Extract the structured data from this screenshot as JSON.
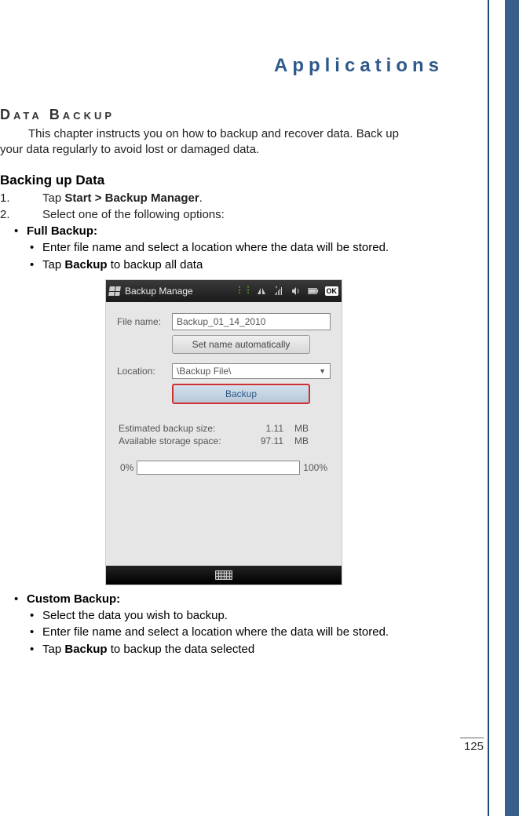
{
  "page_number": "125",
  "chapter_title": "Applications",
  "section_title": "Data Backup",
  "intro_line1": "This chapter instructs you on how to backup and recover data. Back up",
  "intro_line2": "your data regularly to avoid lost or damaged data.",
  "sub_heading": "Backing up Data",
  "steps": {
    "s1_num": "1.",
    "s1_pre": "Tap ",
    "s1_bold": "Start > Backup Manager",
    "s1_post": ".",
    "s2_num": "2.",
    "s2_text": "Select one of the following options:"
  },
  "full_backup": {
    "label": "Full Backup:",
    "b1": "Enter file name and select a location where the data will be stored.",
    "b2_pre": "Tap ",
    "b2_bold": "Backup",
    "b2_post": " to backup all data"
  },
  "custom_backup": {
    "label": "Custom Backup:",
    "b1": "Select the data you wish to backup.",
    "b2": "Enter file name and select a location where the data will be stored.",
    "b3_pre": "Tap ",
    "b3_bold": "Backup",
    "b3_post": " to backup the data selected"
  },
  "screenshot": {
    "titlebar_text": "Backup Manage",
    "ok_label": "OK",
    "file_name_label": "File name:",
    "file_name_value": "Backup_01_14_2010",
    "auto_name_btn": "Set name automatically",
    "location_label": "Location:",
    "location_value": "\\Backup File\\",
    "backup_btn": "Backup",
    "est_label": "Estimated backup size:",
    "est_val": "1.11",
    "est_unit": "MB",
    "avail_label": "Available storage space:",
    "avail_val": "97.11",
    "avail_unit": "MB",
    "pct0": "0%",
    "pct100": "100%"
  }
}
